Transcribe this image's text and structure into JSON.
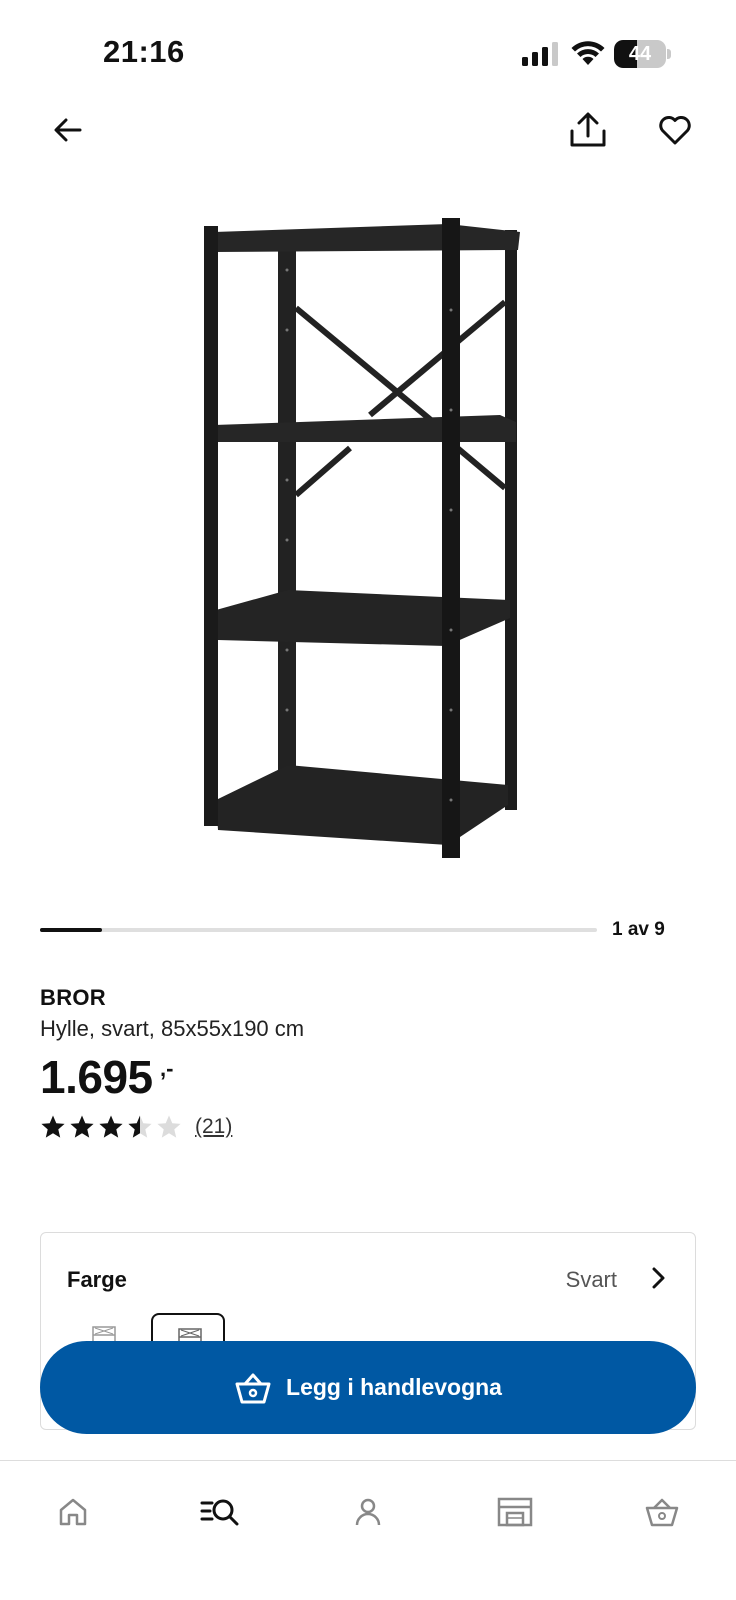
{
  "status_bar": {
    "time": "21:16",
    "battery_level": "44",
    "battery_fraction": 0.44,
    "icons": [
      "signal-icon",
      "wifi-icon",
      "battery-icon"
    ]
  },
  "topbar": {
    "icons": [
      "back-arrow-icon",
      "share-icon",
      "heart-icon"
    ]
  },
  "gallery": {
    "counter": "1 av 9",
    "current": 1,
    "total": 9,
    "image_icon": "shelving-unit-image"
  },
  "product": {
    "name": "BROR",
    "description": "Hylle, svart, 85x55x190 cm",
    "price": "1.695",
    "price_suffix": ",-",
    "rating_value": 3.5,
    "rating_max": 5,
    "review_count": "(21)"
  },
  "color_selector": {
    "label": "Farge",
    "value": "Svart",
    "chevron_icon": "chevron-right-icon"
  },
  "cart_button": {
    "label": "Legg i handlevogna",
    "icon": "shopping-basket-icon",
    "color": "#0058a3"
  },
  "bottom_nav": {
    "items": [
      "home-icon",
      "search-icon",
      "profile-icon",
      "store-icon",
      "cart-icon"
    ],
    "active": "search-icon"
  },
  "colors": {
    "accent": "#0058a3",
    "text": "#111111",
    "star_filled": "#111111",
    "star_empty": "#dcdcdc"
  }
}
